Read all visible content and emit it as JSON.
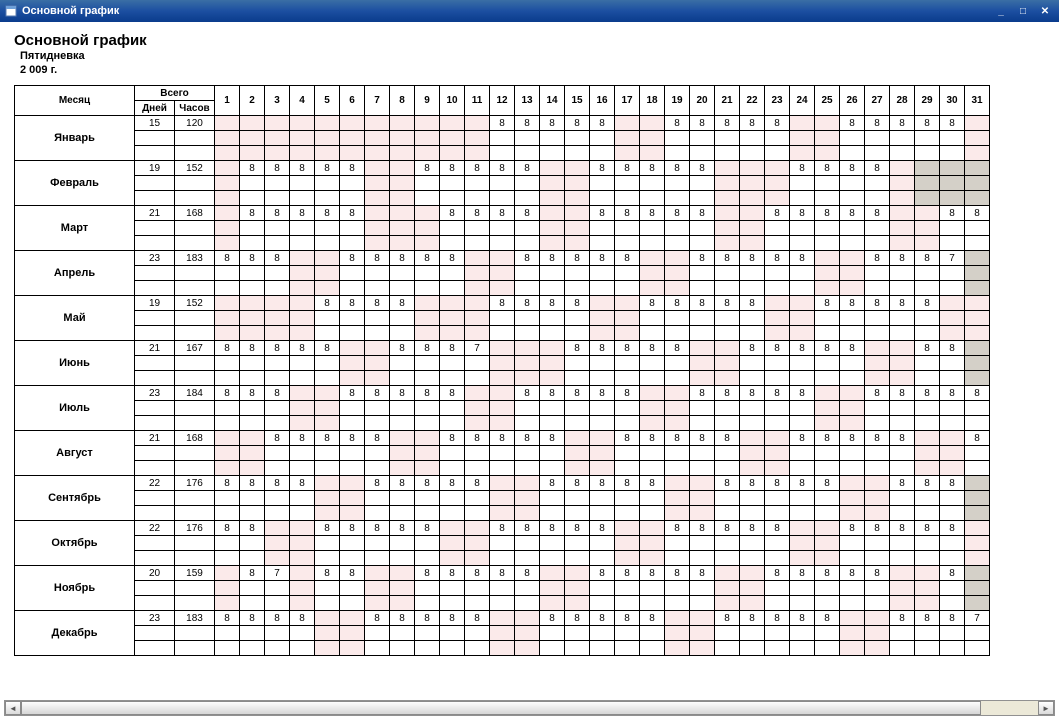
{
  "window": {
    "title": "Основной график"
  },
  "page": {
    "title": "Основной график",
    "subtitle1": "Пятидневка",
    "subtitle2": "2 009 г."
  },
  "headers": {
    "month": "Месяц",
    "total": "Всего",
    "days": "Дней",
    "hours": "Часов"
  },
  "dayNumbers": [
    1,
    2,
    3,
    4,
    5,
    6,
    7,
    8,
    9,
    10,
    11,
    12,
    13,
    14,
    15,
    16,
    17,
    18,
    19,
    20,
    21,
    22,
    23,
    24,
    25,
    26,
    27,
    28,
    29,
    30,
    31
  ],
  "months": [
    {
      "name": "Январь",
      "days": 15,
      "hours": 120,
      "cells": [
        "",
        "",
        "",
        "",
        "",
        "",
        "",
        "",
        "",
        "",
        "",
        "8",
        "8",
        "8",
        "8",
        "8",
        "",
        "",
        "8",
        "8",
        "8",
        "8",
        "8",
        "",
        "",
        "8",
        "8",
        "8",
        "8",
        "8",
        ""
      ],
      "weekend": [
        1,
        2,
        3,
        4,
        5,
        6,
        7,
        8,
        9,
        10,
        11,
        17,
        18,
        24,
        25,
        31
      ],
      "gray": []
    },
    {
      "name": "Февраль",
      "days": 19,
      "hours": 152,
      "cells": [
        "",
        "8",
        "8",
        "8",
        "8",
        "8",
        "",
        "",
        "8",
        "8",
        "8",
        "8",
        "8",
        "",
        "",
        "8",
        "8",
        "8",
        "8",
        "8",
        "",
        "",
        "",
        "8",
        "8",
        "8",
        "8",
        "",
        "",
        "",
        ""
      ],
      "weekend": [
        1,
        7,
        8,
        14,
        15,
        21,
        22,
        23,
        28
      ],
      "gray": [
        29,
        30,
        31
      ]
    },
    {
      "name": "Март",
      "days": 21,
      "hours": 168,
      "cells": [
        "",
        "8",
        "8",
        "8",
        "8",
        "8",
        "",
        "",
        "",
        "8",
        "8",
        "8",
        "8",
        "",
        "",
        "8",
        "8",
        "8",
        "8",
        "8",
        "",
        "",
        "8",
        "8",
        "8",
        "8",
        "8",
        "",
        "",
        "8",
        "8"
      ],
      "weekend": [
        1,
        7,
        8,
        9,
        14,
        15,
        21,
        22,
        28,
        29
      ],
      "gray": []
    },
    {
      "name": "Апрель",
      "days": 23,
      "hours": 183,
      "cells": [
        "8",
        "8",
        "8",
        "",
        "",
        "8",
        "8",
        "8",
        "8",
        "8",
        "",
        "",
        "8",
        "8",
        "8",
        "8",
        "8",
        "",
        "",
        "8",
        "8",
        "8",
        "8",
        "8",
        "",
        "",
        "8",
        "8",
        "8",
        "7",
        ""
      ],
      "weekend": [
        4,
        5,
        11,
        12,
        18,
        19,
        25,
        26
      ],
      "gray": [
        31
      ]
    },
    {
      "name": "Май",
      "days": 19,
      "hours": 152,
      "cells": [
        "",
        "",
        "",
        "",
        "8",
        "8",
        "8",
        "8",
        "",
        "",
        "",
        "8",
        "8",
        "8",
        "8",
        "",
        "",
        "8",
        "8",
        "8",
        "8",
        "8",
        "",
        "",
        "8",
        "8",
        "8",
        "8",
        "8",
        "",
        ""
      ],
      "weekend": [
        1,
        2,
        3,
        4,
        9,
        10,
        11,
        16,
        17,
        23,
        24,
        30,
        31
      ],
      "gray": []
    },
    {
      "name": "Июнь",
      "days": 21,
      "hours": 167,
      "cells": [
        "8",
        "8",
        "8",
        "8",
        "8",
        "",
        "",
        "8",
        "8",
        "8",
        "7",
        "",
        "",
        "",
        "8",
        "8",
        "8",
        "8",
        "8",
        "",
        "",
        "8",
        "8",
        "8",
        "8",
        "8",
        "",
        "",
        "8",
        "8",
        ""
      ],
      "weekend": [
        6,
        7,
        12,
        13,
        14,
        20,
        21,
        27,
        28
      ],
      "gray": [
        31
      ]
    },
    {
      "name": "Июль",
      "days": 23,
      "hours": 184,
      "cells": [
        "8",
        "8",
        "8",
        "",
        "",
        "8",
        "8",
        "8",
        "8",
        "8",
        "",
        "",
        "8",
        "8",
        "8",
        "8",
        "8",
        "",
        "",
        "8",
        "8",
        "8",
        "8",
        "8",
        "",
        "",
        "8",
        "8",
        "8",
        "8",
        "8"
      ],
      "weekend": [
        4,
        5,
        11,
        12,
        18,
        19,
        25,
        26
      ],
      "gray": []
    },
    {
      "name": "Август",
      "days": 21,
      "hours": 168,
      "cells": [
        "",
        "",
        "8",
        "8",
        "8",
        "8",
        "8",
        "",
        "",
        "8",
        "8",
        "8",
        "8",
        "8",
        "",
        "",
        "8",
        "8",
        "8",
        "8",
        "8",
        "",
        "",
        "8",
        "8",
        "8",
        "8",
        "8",
        "",
        "",
        "8"
      ],
      "weekend": [
        1,
        2,
        8,
        9,
        15,
        16,
        22,
        23,
        29,
        30
      ],
      "gray": []
    },
    {
      "name": "Сентябрь",
      "days": 22,
      "hours": 176,
      "cells": [
        "8",
        "8",
        "8",
        "8",
        "",
        "",
        "8",
        "8",
        "8",
        "8",
        "8",
        "",
        "",
        "8",
        "8",
        "8",
        "8",
        "8",
        "",
        "",
        "8",
        "8",
        "8",
        "8",
        "8",
        "",
        "",
        "8",
        "8",
        "8",
        ""
      ],
      "weekend": [
        5,
        6,
        12,
        13,
        19,
        20,
        26,
        27
      ],
      "gray": [
        31
      ]
    },
    {
      "name": "Октябрь",
      "days": 22,
      "hours": 176,
      "cells": [
        "8",
        "8",
        "",
        "",
        "8",
        "8",
        "8",
        "8",
        "8",
        "",
        "",
        "8",
        "8",
        "8",
        "8",
        "8",
        "",
        "",
        "8",
        "8",
        "8",
        "8",
        "8",
        "",
        "",
        "8",
        "8",
        "8",
        "8",
        "8",
        ""
      ],
      "weekend": [
        3,
        4,
        10,
        11,
        17,
        18,
        24,
        25,
        31
      ],
      "gray": []
    },
    {
      "name": "Ноябрь",
      "days": 20,
      "hours": 159,
      "cells": [
        "",
        "8",
        "7",
        "",
        "8",
        "8",
        "",
        "",
        "8",
        "8",
        "8",
        "8",
        "8",
        "",
        "",
        "8",
        "8",
        "8",
        "8",
        "8",
        "",
        "",
        "8",
        "8",
        "8",
        "8",
        "8",
        "",
        "",
        "8",
        ""
      ],
      "weekend": [
        1,
        4,
        7,
        8,
        14,
        15,
        21,
        22,
        28,
        29
      ],
      "gray": [
        31
      ]
    },
    {
      "name": "Декабрь",
      "days": 23,
      "hours": 183,
      "cells": [
        "8",
        "8",
        "8",
        "8",
        "",
        "",
        "8",
        "8",
        "8",
        "8",
        "8",
        "",
        "",
        "8",
        "8",
        "8",
        "8",
        "8",
        "",
        "",
        "8",
        "8",
        "8",
        "8",
        "8",
        "",
        "",
        "8",
        "8",
        "8",
        "7"
      ],
      "weekend": [
        5,
        6,
        12,
        13,
        19,
        20,
        26,
        27
      ],
      "gray": []
    }
  ]
}
